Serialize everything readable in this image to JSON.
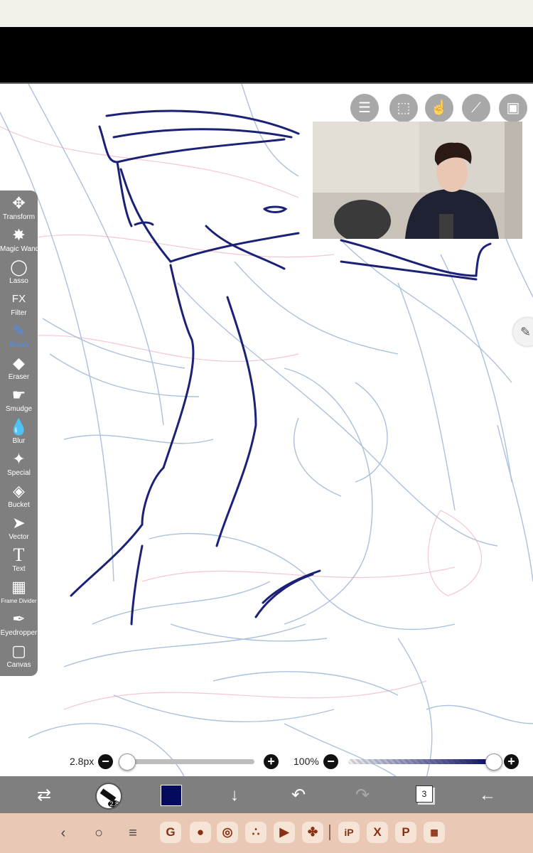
{
  "toolbar": {
    "tools": [
      {
        "label": "Transform",
        "icon": "✥"
      },
      {
        "label": "Magic Wand",
        "icon": "✸"
      },
      {
        "label": "Lasso",
        "icon": "◯"
      },
      {
        "label": "Filter",
        "icon": "FX"
      },
      {
        "label": "Brush",
        "icon": "✎"
      },
      {
        "label": "Eraser",
        "icon": "◆"
      },
      {
        "label": "Smudge",
        "icon": "☛"
      },
      {
        "label": "Blur",
        "icon": "💧"
      },
      {
        "label": "Special",
        "icon": "✦"
      },
      {
        "label": "Bucket",
        "icon": "◈"
      },
      {
        "label": "Vector",
        "icon": "➤"
      },
      {
        "label": "Text",
        "icon": "T"
      },
      {
        "label": "Frame Divider",
        "icon": "▦"
      },
      {
        "label": "Eyedropper",
        "icon": "✒"
      },
      {
        "label": "Canvas",
        "icon": "▢"
      }
    ],
    "active_tool": "Brush"
  },
  "brush": {
    "size_label": "2.8px",
    "size_fraction": 0.0,
    "opacity_label": "100%",
    "opacity_fraction": 1.0,
    "color": "#050a5e",
    "brush_badge": "2.8"
  },
  "layers": {
    "count": "3"
  },
  "colors": {
    "toolbar": "#7f7f7f",
    "accent": "#4b8ef5",
    "navbar": "#e9c9b6"
  }
}
